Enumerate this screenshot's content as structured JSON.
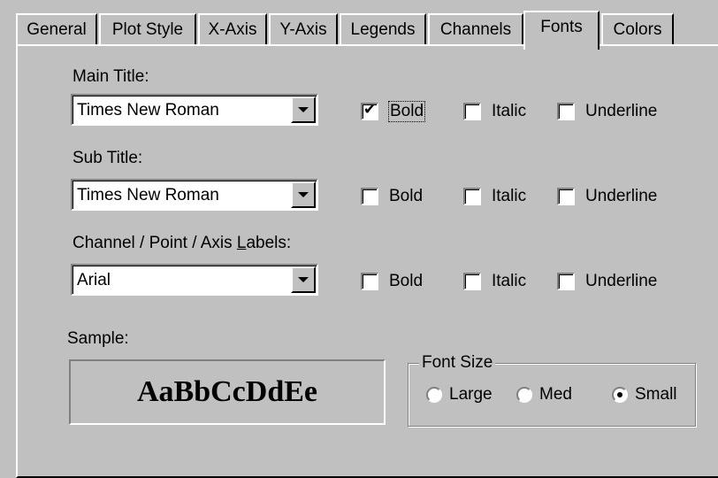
{
  "tabs": [
    {
      "label": "General",
      "active": false
    },
    {
      "label": "Plot Style",
      "active": false
    },
    {
      "label": "X-Axis",
      "active": false
    },
    {
      "label": "Y-Axis",
      "active": false
    },
    {
      "label": "Legends",
      "active": false
    },
    {
      "label": "Channels",
      "active": false
    },
    {
      "label": "Fonts",
      "active": true
    },
    {
      "label": "Colors",
      "active": false
    }
  ],
  "main_title": {
    "label": "Main Title:",
    "font": "Times New Roman",
    "bold": {
      "label": "Bold",
      "checked": true
    },
    "italic": {
      "label": "Italic",
      "checked": false
    },
    "underline": {
      "label": "Underline",
      "checked": false
    }
  },
  "sub_title": {
    "label": "Sub Title:",
    "font": "Times New Roman",
    "bold": {
      "label": "Bold",
      "checked": false
    },
    "italic": {
      "label": "Italic",
      "checked": false
    },
    "underline": {
      "label": "Underline",
      "checked": false
    }
  },
  "labels": {
    "label_pre": "Channel / Point / Axis ",
    "label_key": "L",
    "label_post": "abels:",
    "font": "Arial",
    "bold": {
      "label": "Bold",
      "checked": false
    },
    "italic": {
      "label": "Italic",
      "checked": false
    },
    "underline": {
      "label": "Underline",
      "checked": false
    }
  },
  "sample": {
    "label": "Sample:",
    "text": "AaBbCcDdEe"
  },
  "font_size": {
    "legend": "Font Size",
    "options": [
      {
        "label": "Large",
        "selected": false
      },
      {
        "label": "Med",
        "selected": false
      },
      {
        "label": "Small",
        "selected": true
      }
    ]
  },
  "check_mark": "✔"
}
